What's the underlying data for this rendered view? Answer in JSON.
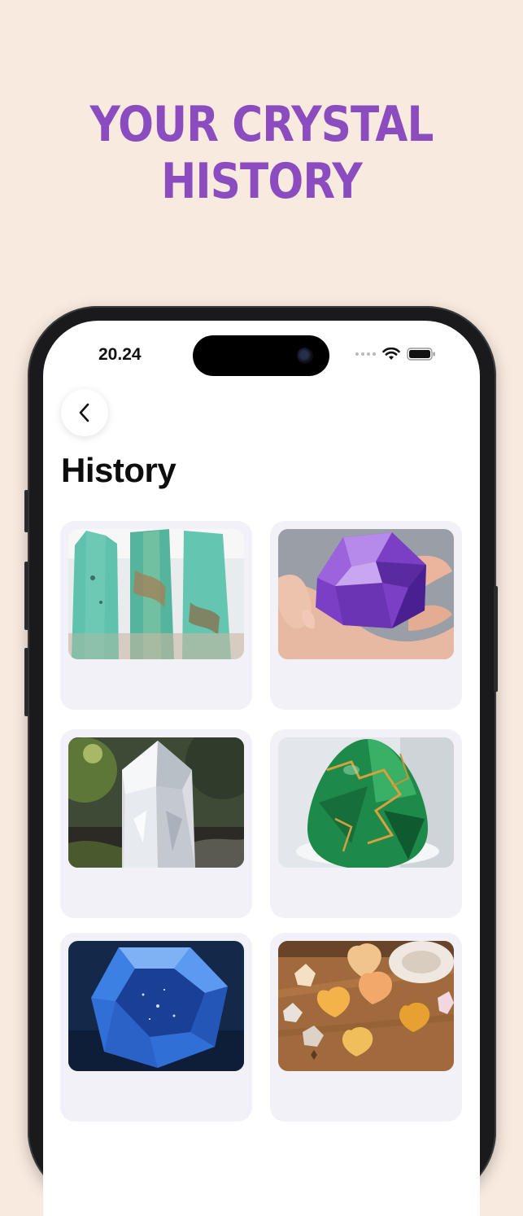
{
  "headline": {
    "line1": "YOUR CRYSTAL",
    "line2": "HISTORY"
  },
  "status_bar": {
    "time": "20.24"
  },
  "page": {
    "title": "History"
  },
  "history": {
    "items": [
      {
        "icon": "amazonite-towers-image"
      },
      {
        "icon": "amethyst-in-hand-image"
      },
      {
        "icon": "clear-quartz-point-image"
      },
      {
        "icon": "green-gemstone-egg-image"
      },
      {
        "icon": "blue-faceted-gem-image"
      },
      {
        "icon": "citrine-hearts-image"
      }
    ]
  },
  "colors": {
    "background": "#f8eadf",
    "headline": "#8b4cc0",
    "card": "#f2f1f7"
  }
}
